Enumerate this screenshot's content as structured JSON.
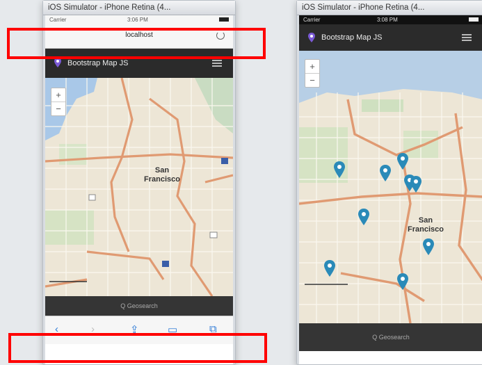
{
  "left_sim": {
    "title": "iOS Simulator - iPhone Retina (4...",
    "status": {
      "carrier": "Carrier",
      "time": "3:06 PM"
    },
    "url": "localhost",
    "brand": "Bootstrap Map JS",
    "map_label": "San Francisco",
    "search_label": "Q Geosearch"
  },
  "right_sim": {
    "title": "iOS Simulator - iPhone Retina (4...",
    "status": {
      "carrier": "Carrier",
      "time": "3:08 PM"
    },
    "brand": "Bootstrap Map JS",
    "map_label": "San Francisco",
    "search_label": "Q Geosearch"
  },
  "colors": {
    "highlight": "#ff0000",
    "navbar": "#2b2b2b",
    "ios_blue": "#2f7bd6",
    "marker": "#2a8ab8",
    "brand_pin": "#7b5ad6"
  },
  "icons": {
    "back": "chevron-left-icon",
    "forward": "chevron-right-icon",
    "share": "share-icon",
    "bookmarks": "book-icon",
    "tabs": "tabs-icon"
  }
}
